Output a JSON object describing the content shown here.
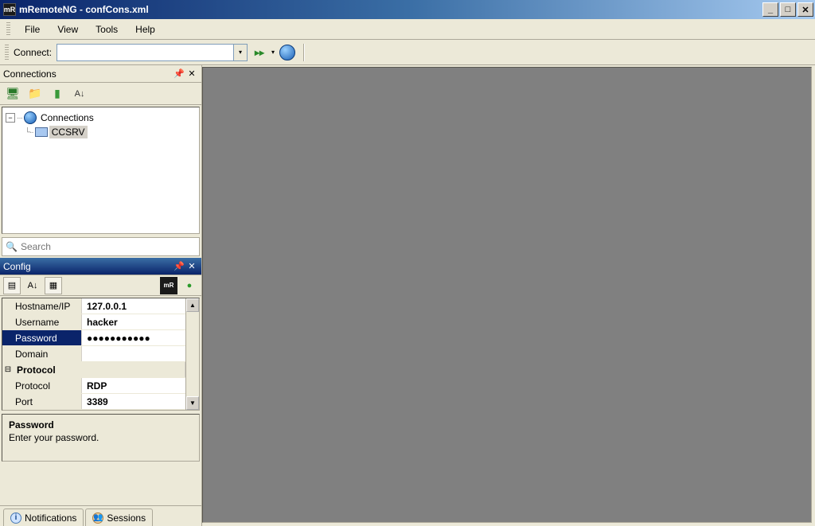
{
  "window": {
    "title": "mRemoteNG - confCons.xml",
    "icon_text": "mR"
  },
  "menu": {
    "file": "File",
    "view": "View",
    "tools": "Tools",
    "help": "Help"
  },
  "connectbar": {
    "label": "Connect:"
  },
  "panels": {
    "connections_title": "Connections",
    "config_title": "Config"
  },
  "tree": {
    "root": "Connections",
    "item1": "CCSRV"
  },
  "search": {
    "placeholder": "Search"
  },
  "config": {
    "rows": {
      "hostname_label": "Hostname/IP",
      "hostname_value": "127.0.0.1",
      "username_label": "Username",
      "username_value": "hacker",
      "password_label": "Password",
      "password_value": "●●●●●●●●●●●",
      "domain_label": "Domain",
      "domain_value": "",
      "protocol_cat": "Protocol",
      "protocol_label": "Protocol",
      "protocol_value": "RDP",
      "port_label": "Port",
      "port_value": "3389"
    },
    "desc": {
      "title": "Password",
      "text": "Enter your password."
    }
  },
  "bottom_tabs": {
    "notifications": "Notifications",
    "sessions": "Sessions"
  }
}
